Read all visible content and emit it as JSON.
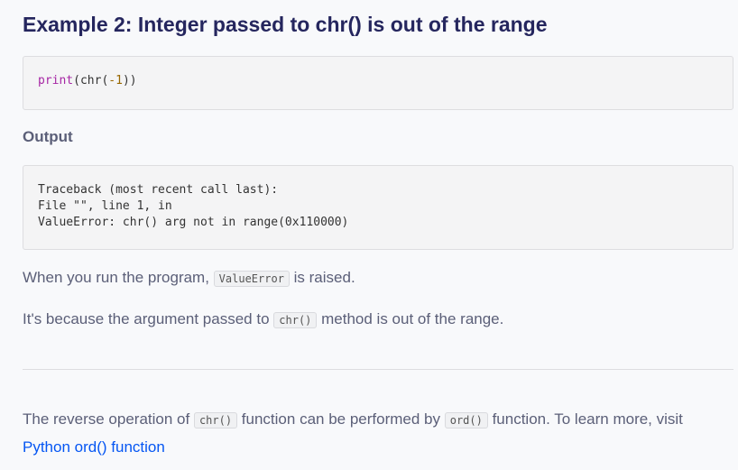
{
  "title": "Example 2: Integer passed to chr() is out of the range",
  "code": {
    "fn": "print",
    "open": "(chr(",
    "num": "-1",
    "close": "))"
  },
  "output_label": "Output",
  "output": "Traceback (most recent call last):\nFile \"\", line 1, in\nValueError: chr() arg not in range(0x110000)",
  "p1": {
    "a": "When you run the program, ",
    "code": "ValueError",
    "b": " is raised."
  },
  "p2": {
    "a": "It's because the argument passed to ",
    "code": "chr()",
    "b": " method is out of the range."
  },
  "p3": {
    "a": "The reverse operation of ",
    "code1": "chr()",
    "b": " function can be performed by ",
    "code2": "ord()",
    "c": " function. To learn more, visit ",
    "link": "Python ord() function"
  }
}
